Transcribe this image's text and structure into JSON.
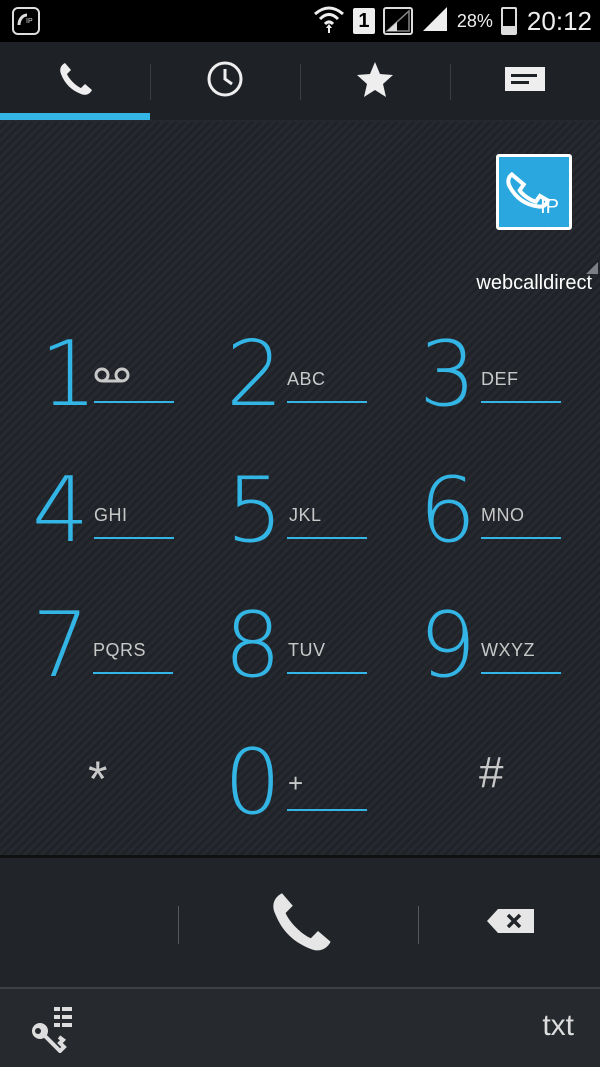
{
  "status_bar": {
    "sim_slot": "1",
    "battery_percent": "28%",
    "battery_level": 0.28,
    "time": "20:12",
    "icons": [
      "app-notification-icon",
      "wifi-icon",
      "sim-icon",
      "signal-icon",
      "battery-icon"
    ]
  },
  "tabs": [
    {
      "name": "dialer",
      "icon": "phone-icon",
      "active": true
    },
    {
      "name": "recents",
      "icon": "clock-icon",
      "active": false
    },
    {
      "name": "favorites",
      "icon": "star-icon",
      "active": false
    },
    {
      "name": "contacts",
      "icon": "contact-card-icon",
      "active": false
    }
  ],
  "ip_button": {
    "label": "IP",
    "icon": "ip-call-icon"
  },
  "provider": {
    "label": "webcalldirect"
  },
  "keys": [
    {
      "digit": "1",
      "letters": "",
      "icon": "voicemail-icon"
    },
    {
      "digit": "2",
      "letters": "ABC"
    },
    {
      "digit": "3",
      "letters": "DEF"
    },
    {
      "digit": "4",
      "letters": "GHI"
    },
    {
      "digit": "5",
      "letters": "JKL"
    },
    {
      "digit": "6",
      "letters": "MNO"
    },
    {
      "digit": "7",
      "letters": "PQRS"
    },
    {
      "digit": "8",
      "letters": "TUV"
    },
    {
      "digit": "9",
      "letters": "WXYZ"
    },
    {
      "digit": "*",
      "letters": ""
    },
    {
      "digit": "0",
      "letters": "+"
    },
    {
      "digit": "#",
      "letters": ""
    }
  ],
  "bottom": {
    "txt_label": "txt",
    "icons": [
      "call-icon",
      "backspace-icon",
      "key-menu-icon"
    ]
  },
  "colors": {
    "accent": "#33b5e5",
    "background": "#1f2328"
  }
}
